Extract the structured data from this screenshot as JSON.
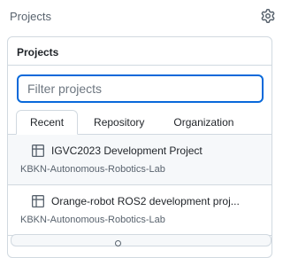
{
  "header": {
    "title": "Projects",
    "settings_icon": "gear-icon"
  },
  "panel": {
    "title": "Projects",
    "filter": {
      "placeholder": "Filter projects",
      "value": ""
    },
    "tabs": [
      {
        "label": "Recent",
        "active": true
      },
      {
        "label": "Repository",
        "active": false
      },
      {
        "label": "Organization",
        "active": false
      }
    ],
    "items": [
      {
        "name": "IGVC2023 Development Project",
        "owner": "KBKN-Autonomous-Robotics-Lab",
        "icon": "table-icon"
      },
      {
        "name": "Orange-robot ROS2 development proj...",
        "owner": "KBKN-Autonomous-Robotics-Lab",
        "icon": "table-icon"
      }
    ]
  },
  "colors": {
    "accent": "#0969da",
    "border": "#d1d9e0",
    "muted": "#59636e",
    "hover_bg": "#f6f8fa"
  }
}
